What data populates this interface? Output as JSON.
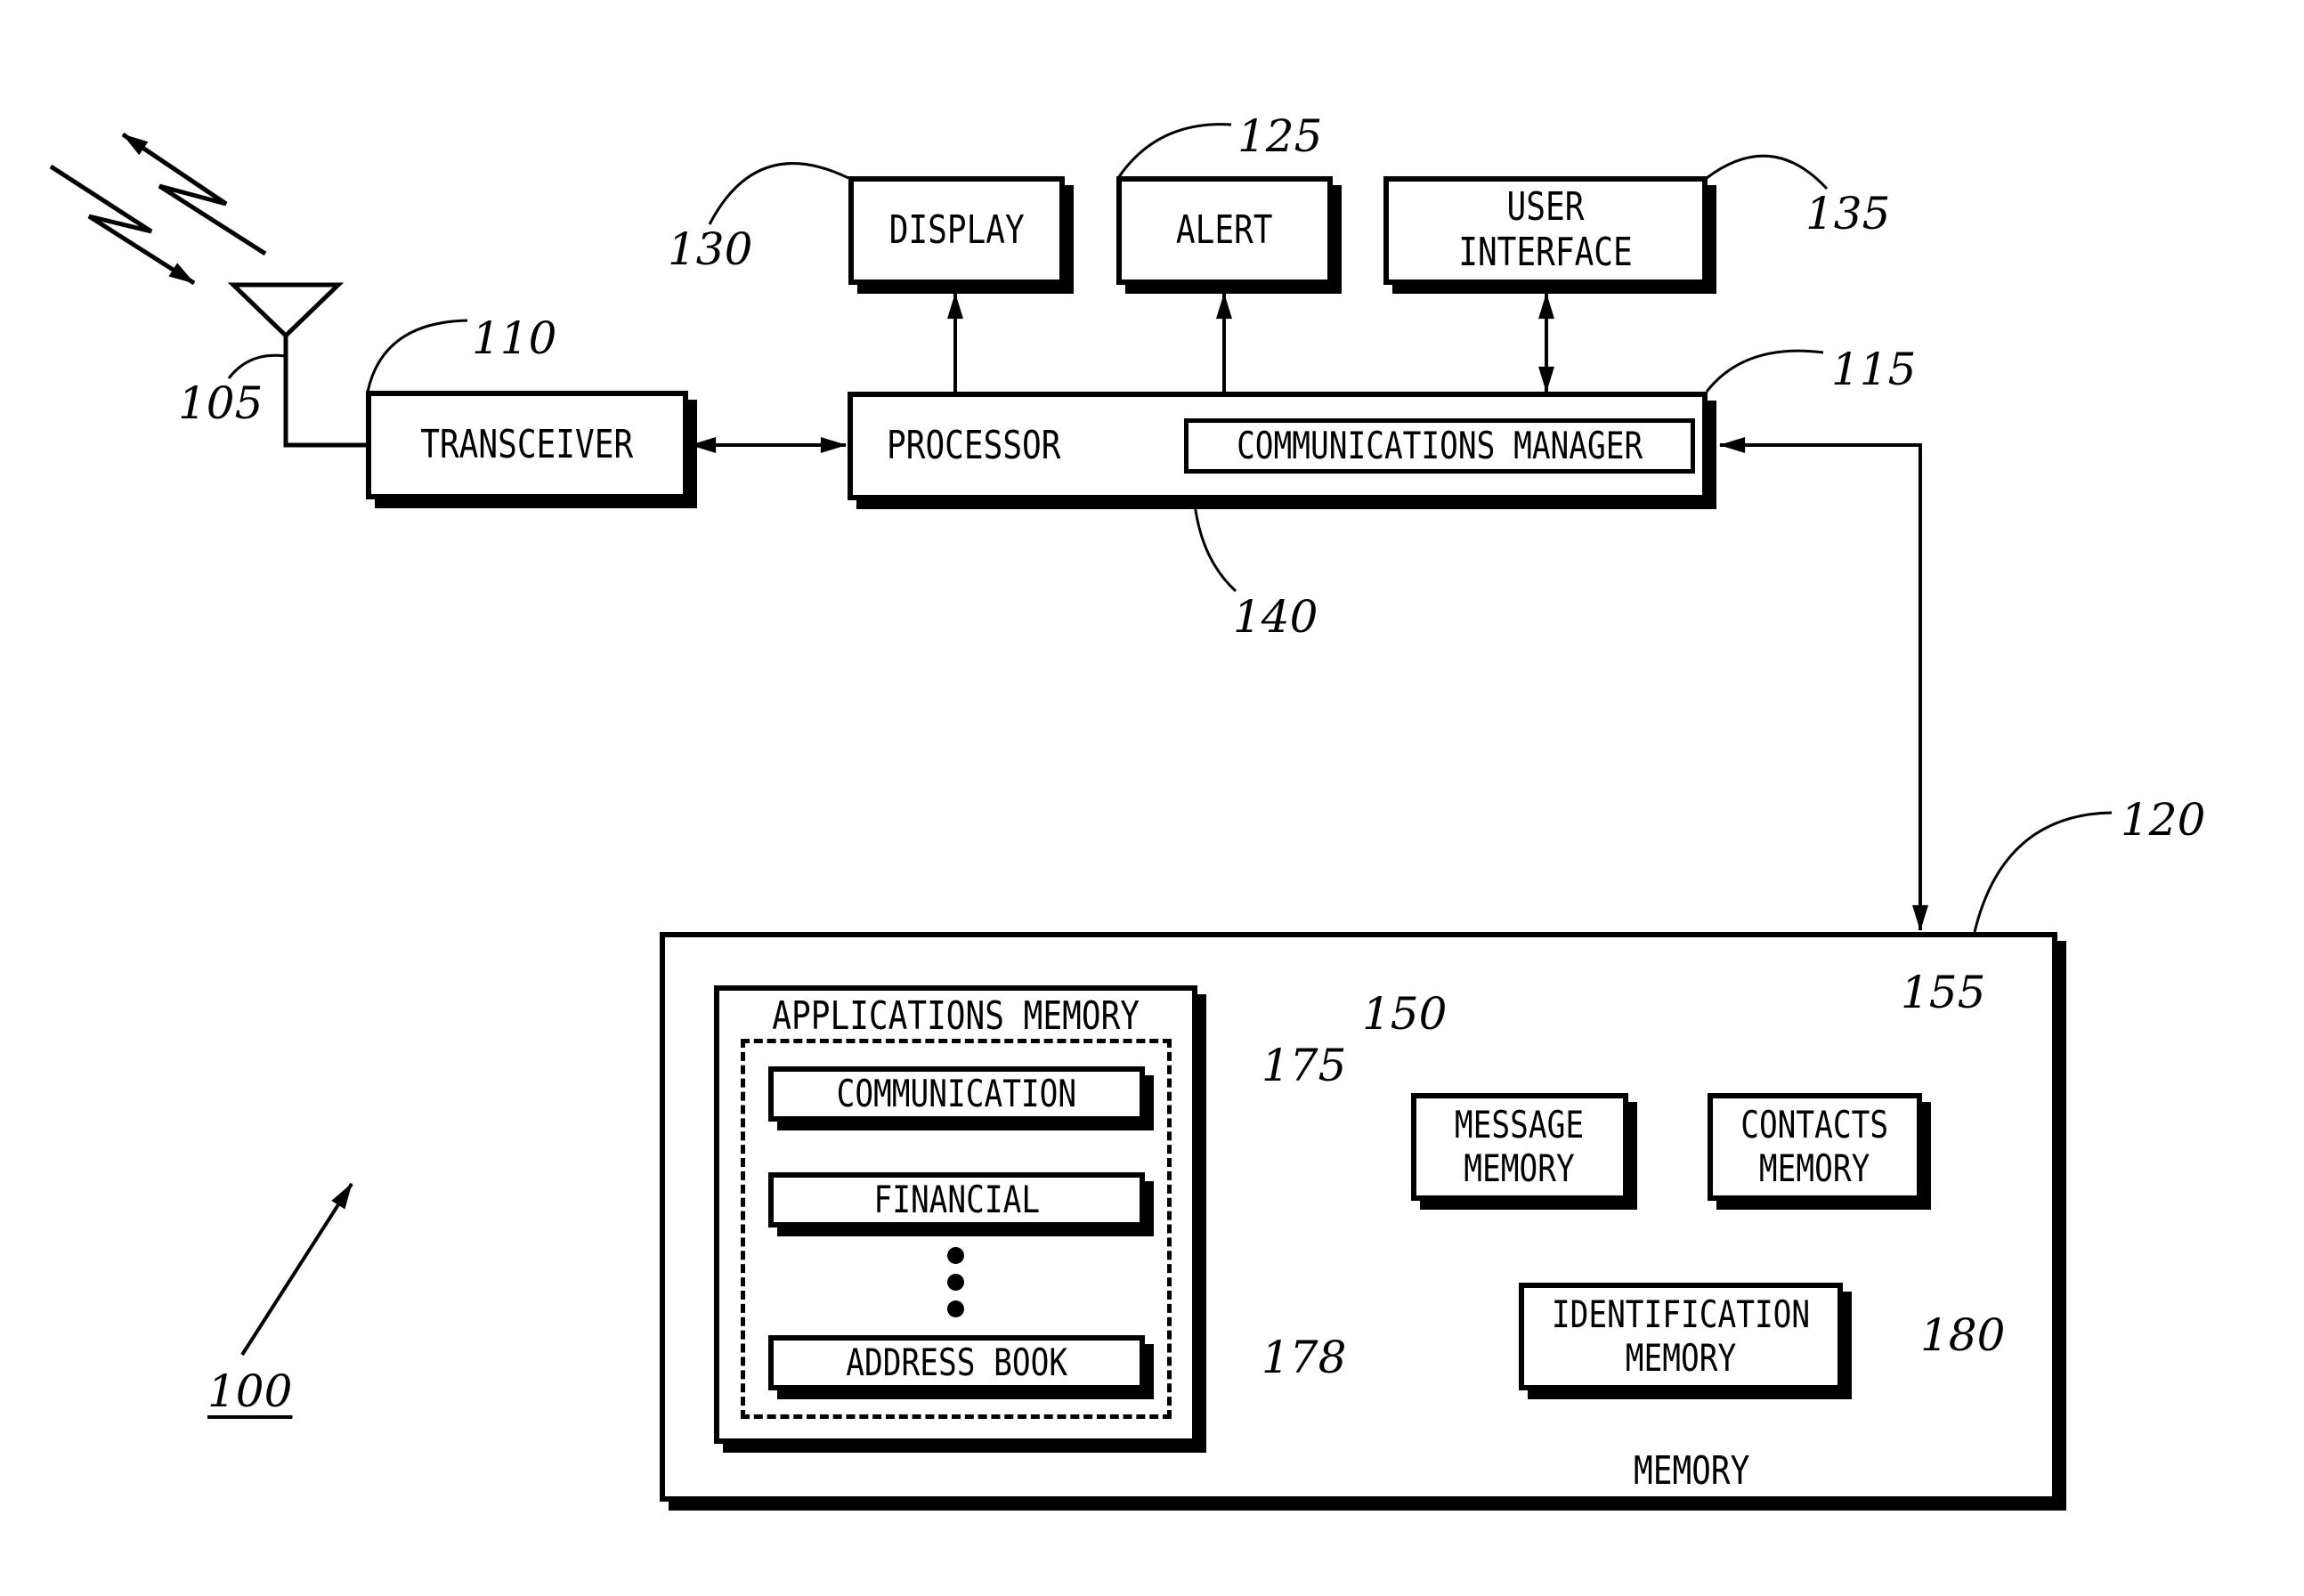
{
  "figure": {
    "reference": "100",
    "blocks": {
      "antenna": {
        "ref": "105"
      },
      "transceiver": {
        "label": "TRANSCEIVER",
        "ref": "110"
      },
      "processor": {
        "label": "PROCESSOR",
        "ref": "115"
      },
      "communications_manager": {
        "label": "COMMUNICATIONS MANAGER",
        "ref": "140"
      },
      "display": {
        "label": "DISPLAY",
        "ref": "130"
      },
      "alert": {
        "label": "ALERT",
        "ref": "125"
      },
      "user_interface": {
        "label": "USER INTERFACE",
        "ref": "135"
      },
      "memory": {
        "label": "MEMORY",
        "ref": "120"
      },
      "applications_memory": {
        "label": "APPLICATIONS MEMORY",
        "ref": "175",
        "group_ref": "178"
      },
      "applications": [
        {
          "label": "COMMUNICATION"
        },
        {
          "label": "FINANCIAL"
        },
        {
          "label": "ADDRESS BOOK"
        }
      ],
      "message_memory": {
        "label": "MESSAGE\nMEMORY",
        "ref": "150"
      },
      "contacts_memory": {
        "label": "CONTACTS\nMEMORY",
        "ref": "155"
      },
      "identification_memory": {
        "label": "IDENTIFICATION\nMEMORY",
        "ref": "180"
      }
    },
    "connections": [
      {
        "from": "antenna",
        "to": "transceiver",
        "type": "line"
      },
      {
        "from": "transceiver",
        "to": "processor",
        "type": "bidirectional"
      },
      {
        "from": "processor",
        "to": "display",
        "type": "unidirectional"
      },
      {
        "from": "processor",
        "to": "alert",
        "type": "unidirectional"
      },
      {
        "from": "processor",
        "to": "user_interface",
        "type": "bidirectional"
      },
      {
        "from": "processor",
        "to": "memory",
        "type": "bidirectional"
      }
    ]
  }
}
